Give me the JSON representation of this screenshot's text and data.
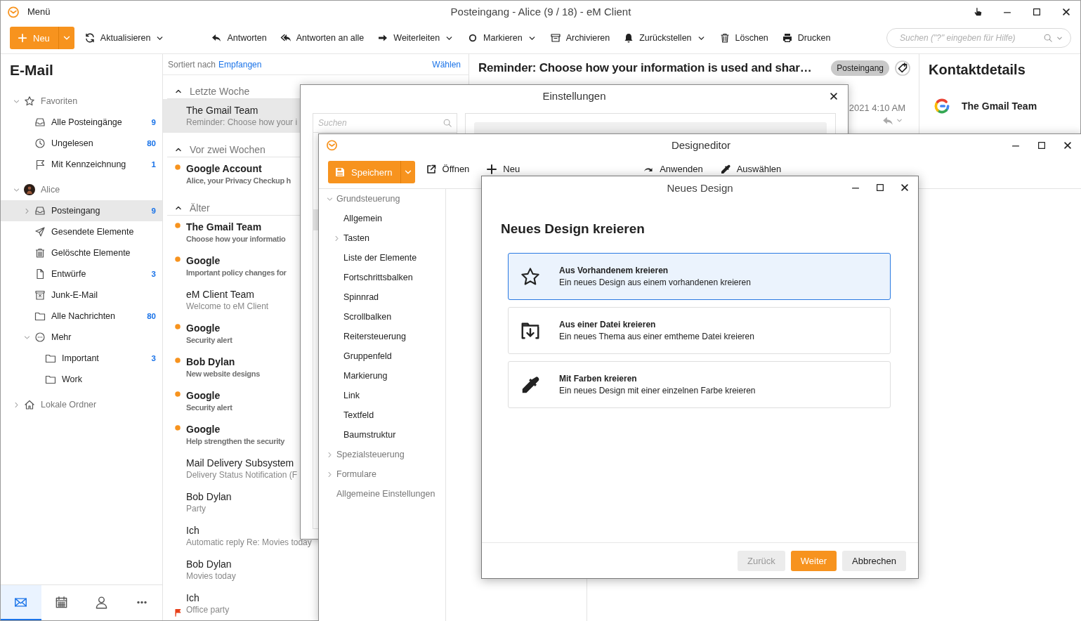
{
  "main_window": {
    "menu": "Menü",
    "title": "Posteingang - Alice (9 / 18) - eM Client"
  },
  "toolbar": [
    {
      "kind": "new",
      "label": "Neu",
      "dropdown": true
    },
    {
      "kind": "refresh",
      "label": "Aktualisieren",
      "dropdown": true
    },
    {
      "kind": "reply",
      "label": "Antworten",
      "dropdown": false
    },
    {
      "kind": "reply-all",
      "label": "Antworten an alle",
      "dropdown": false
    },
    {
      "kind": "forward",
      "label": "Weiterleiten",
      "dropdown": true
    },
    {
      "kind": "mark",
      "label": "Markieren",
      "dropdown": true
    },
    {
      "kind": "archive",
      "label": "Archivieren",
      "dropdown": false
    },
    {
      "kind": "snooze",
      "label": "Zurückstellen",
      "dropdown": true
    },
    {
      "kind": "delete",
      "label": "Löschen",
      "dropdown": false
    },
    {
      "kind": "print",
      "label": "Drucken",
      "dropdown": false
    }
  ],
  "search": {
    "placeholder": "Suchen (\"?\" eingeben für Hilfe)"
  },
  "sidebar": {
    "title": "E-Mail",
    "tree": [
      {
        "kind": "favorites",
        "label": "Favoriten",
        "expanded": true,
        "selected": false,
        "children": [
          {
            "kind": "inbox",
            "label": "Alle Posteingänge",
            "count": "9",
            "selected": false
          },
          {
            "kind": "clock",
            "label": "Ungelesen",
            "count": "80",
            "selected": false
          },
          {
            "kind": "flag",
            "label": "Mit Kennzeichnung",
            "count": "1",
            "selected": false
          }
        ]
      },
      {
        "kind": "account",
        "label": "Alice",
        "expanded": true,
        "selected": false,
        "children": [
          {
            "kind": "inbox",
            "label": "Posteingang",
            "count": "9",
            "expanded": false,
            "selected": true
          },
          {
            "kind": "sent",
            "label": "Gesendete Elemente",
            "selected": false
          },
          {
            "kind": "trash",
            "label": "Gelöschte Elemente",
            "selected": false
          },
          {
            "kind": "drafts",
            "label": "Entwürfe",
            "count": "3",
            "selected": false
          },
          {
            "kind": "junk",
            "label": "Junk-E-Mail",
            "selected": false
          },
          {
            "kind": "folder",
            "label": "Alle Nachrichten",
            "count": "80",
            "selected": false
          },
          {
            "kind": "more",
            "label": "Mehr",
            "expanded": true,
            "selected": false,
            "children": [
              {
                "kind": "folder",
                "label": "Important",
                "count": "3",
                "selected": false
              },
              {
                "kind": "folder",
                "label": "Work",
                "selected": false
              }
            ]
          }
        ]
      },
      {
        "kind": "local",
        "label": "Lokale Ordner",
        "expanded": false,
        "selected": false
      }
    ],
    "nav_tabs": [
      {
        "kind": "mail",
        "selected": true
      },
      {
        "kind": "calendar",
        "selected": false
      },
      {
        "kind": "contacts",
        "selected": false
      },
      {
        "kind": "more",
        "selected": false
      }
    ]
  },
  "message_list": {
    "sort_label": "Sortiert nach",
    "sort_value": "Empfangen",
    "select_link": "Wählen",
    "groups": [
      {
        "label": "Letzte Woche",
        "expanded": true,
        "messages": [
          {
            "sender": "The Gmail Team",
            "subject": "Reminder: Choose how your i",
            "unread": false,
            "flagged": false,
            "selected": true
          }
        ]
      },
      {
        "label": "Vor zwei Wochen",
        "expanded": true,
        "messages": [
          {
            "sender": "Google Account",
            "subject": "Alice, your Privacy Checkup h",
            "unread": true,
            "flagged": false,
            "selected": false
          }
        ]
      },
      {
        "label": "Älter",
        "expanded": true,
        "messages": [
          {
            "sender": "The Gmail Team",
            "subject": "Choose how your informatio",
            "unread": true,
            "flagged": false,
            "selected": false
          },
          {
            "sender": "Google",
            "subject": "Important policy changes for",
            "unread": true,
            "flagged": false,
            "selected": false
          },
          {
            "sender": "eM Client Team",
            "subject": "Welcome to eM Client",
            "unread": false,
            "flagged": false,
            "selected": false
          },
          {
            "sender": "Google",
            "subject": "Security alert",
            "unread": true,
            "flagged": false,
            "selected": false
          },
          {
            "sender": "Bob Dylan",
            "subject": "New website designs",
            "unread": true,
            "flagged": false,
            "selected": false
          },
          {
            "sender": "Google",
            "subject": "Security alert",
            "unread": true,
            "flagged": false,
            "selected": false
          },
          {
            "sender": "Google",
            "subject": "Help strengthen the security",
            "unread": true,
            "flagged": false,
            "selected": false
          },
          {
            "sender": "Mail Delivery Subsystem",
            "subject": "Delivery Status Notification (F",
            "unread": false,
            "flagged": false,
            "selected": false
          },
          {
            "sender": "Bob Dylan",
            "subject": "Party",
            "unread": false,
            "flagged": false,
            "selected": false
          },
          {
            "sender": "Ich",
            "subject": "Automatic reply Re: Movies today",
            "unread": false,
            "flagged": false,
            "selected": false
          },
          {
            "sender": "Bob Dylan",
            "subject": "Movies today",
            "unread": false,
            "flagged": false,
            "selected": false
          },
          {
            "sender": "Ich",
            "subject": "Office party",
            "unread": false,
            "flagged": true,
            "selected": false
          }
        ]
      }
    ]
  },
  "reading_pane": {
    "subject": "Reminder: Choose how your information is used and shar…",
    "folder_tag": "Posteingang",
    "date": "2021 4:10 AM"
  },
  "contact_details": {
    "title": "Kontaktdetails",
    "name": "The Gmail Team"
  },
  "settings_window": {
    "title": "Einstellungen",
    "search_placeholder": "Suchen"
  },
  "design_editor": {
    "title": "Designeditor",
    "toolbar": [
      {
        "kind": "save",
        "label": "Speichern"
      },
      {
        "kind": "open",
        "label": "Öffnen"
      },
      {
        "kind": "new",
        "label": "Neu"
      },
      {
        "kind": "apply",
        "label": "Anwenden"
      },
      {
        "kind": "pick",
        "label": "Auswählen"
      }
    ],
    "tree": [
      {
        "label": "Grundsteuerung",
        "expanded": true,
        "children": [
          {
            "label": "Allgemein"
          },
          {
            "label": "Tasten",
            "expanded": false
          },
          {
            "label": "Liste der Elemente"
          },
          {
            "label": "Fortschrittsbalken"
          },
          {
            "label": "Spinnrad"
          },
          {
            "label": "Scrollbalken"
          },
          {
            "label": "Reitersteuerung"
          },
          {
            "label": "Gruppenfeld"
          },
          {
            "label": "Markierung"
          },
          {
            "label": "Link"
          },
          {
            "label": "Textfeld"
          },
          {
            "label": "Baumstruktur"
          }
        ]
      },
      {
        "label": "Spezialsteuerung",
        "expanded": false
      },
      {
        "label": "Formulare",
        "expanded": false
      },
      {
        "label": "Allgemeine Einstellungen"
      }
    ]
  },
  "new_design_dialog": {
    "title": "Neues Design",
    "heading": "Neues Design kreieren",
    "options": [
      {
        "kind": "existing",
        "title": "Aus Vorhandenem kreieren",
        "description": "Ein neues Design aus einem vorhandenen kreieren",
        "selected": true
      },
      {
        "kind": "file",
        "title": "Aus einer Datei kreieren",
        "description": "Ein neues Thema aus einer emtheme Datei kreieren",
        "selected": false
      },
      {
        "kind": "color",
        "title": "Mit Farben kreieren",
        "description": "Ein neues Design mit einer einzelnen Farbe kreieren",
        "selected": false
      }
    ],
    "buttons": [
      {
        "kind": "secondary",
        "label": "Zurück",
        "disabled": true
      },
      {
        "kind": "primary",
        "label": "Weiter",
        "disabled": false
      },
      {
        "kind": "secondary",
        "label": "Abbrechen",
        "disabled": false
      }
    ]
  }
}
